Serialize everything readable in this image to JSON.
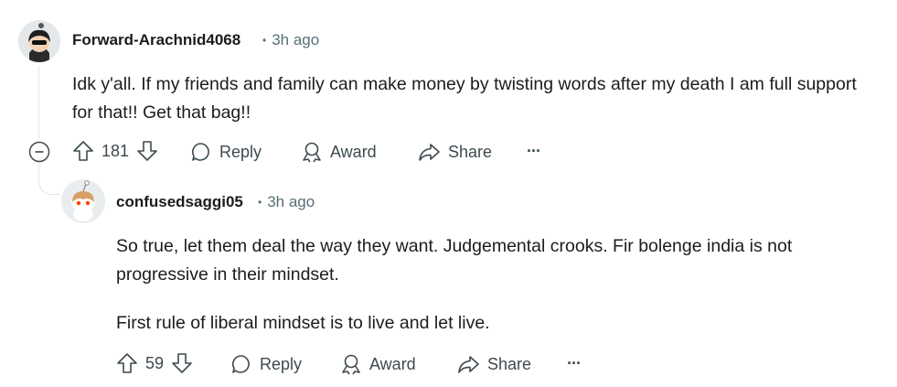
{
  "comments": [
    {
      "username": "Forward-Arachnid4068",
      "age": "3h ago",
      "body": [
        "Idk y'all. If my friends and family can make money by twisting words after my death I am full support for that!! Get that bag!!"
      ],
      "score": "181",
      "actions": {
        "reply": "Reply",
        "award": "Award",
        "share": "Share",
        "more": "···"
      }
    },
    {
      "username": "confusedsaggi05",
      "age": "3h ago",
      "body": [
        "So true, let them deal the way they want. Judgemental crooks. Fir bolenge india is not progressive in their mindset.",
        "First rule of liberal mindset is to live and let live."
      ],
      "score": "59",
      "actions": {
        "reply": "Reply",
        "award": "Award",
        "share": "Share",
        "more": "···"
      }
    }
  ],
  "colors": {
    "text": "#1c1c1c",
    "meta": "#576f76",
    "thread": "#e0e3e5"
  }
}
